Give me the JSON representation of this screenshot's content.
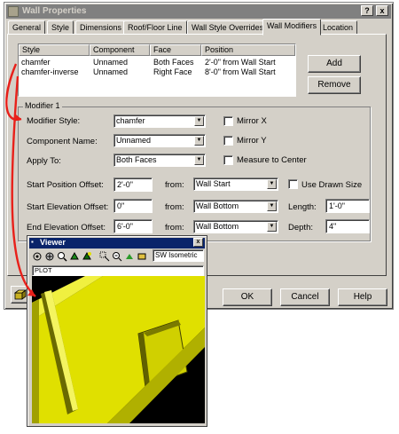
{
  "window": {
    "title": "Wall Properties",
    "close_glyph": "x",
    "help_glyph": "?"
  },
  "tabs": [
    "General",
    "Style",
    "Dimensions",
    "Roof/Floor Line",
    "Wall Style Overrides",
    "Wall Modifiers",
    "Location"
  ],
  "active_tab": "Wall Modifiers",
  "list": {
    "headers": [
      "Style",
      "Component",
      "Face",
      "Position"
    ],
    "rows": [
      [
        "chamfer",
        "Unnamed",
        "Both Faces",
        "2'-0\" from Wall Start"
      ],
      [
        "chamfer-inverse",
        "Unnamed",
        "Right Face",
        "8'-0\" from Wall Start"
      ]
    ]
  },
  "buttons": {
    "add": "Add",
    "remove": "Remove",
    "ok": "OK",
    "cancel": "Cancel",
    "help": "Help"
  },
  "modifier": {
    "group_label": "Modifier 1",
    "style_label": "Modifier Style:",
    "style_value": "chamfer",
    "component_label": "Component Name:",
    "component_value": "Unnamed",
    "apply_label": "Apply To:",
    "apply_value": "Both Faces",
    "mirror_x": "Mirror X",
    "mirror_y": "Mirror Y",
    "measure_center": "Measure to Center",
    "start_pos_label": "Start Position Offset:",
    "start_pos_value": "2'-0\"",
    "start_elev_label": "Start Elevation Offset:",
    "start_elev_value": "0\"",
    "end_elev_label": "End Elevation Offset:",
    "end_elev_value": "6'-0\"",
    "from_label": "from:",
    "from1": "Wall Start",
    "from2": "Wall Bottom",
    "from3": "Wall Bottom",
    "use_drawn_size": "Use Drawn Size",
    "length_label": "Length:",
    "length_value": "1'-0\"",
    "depth_label": "Depth:",
    "depth_value": "4\""
  },
  "viewer": {
    "title": "Viewer",
    "view_value": "SW Isometric",
    "plot_text": "PLOT",
    "icons": [
      "orbit-icon",
      "pan-icon",
      "zoom-icon",
      "shade-icon",
      "render-icon",
      "zoom-window-icon",
      "zoom-realtime-icon",
      "flat-shade-icon",
      "hidden-icon"
    ]
  },
  "colors": {
    "arrow": "#e8201a",
    "wall": "#e0e000",
    "wall_dark": "#8a8a00",
    "title_active": "#0a246a"
  }
}
